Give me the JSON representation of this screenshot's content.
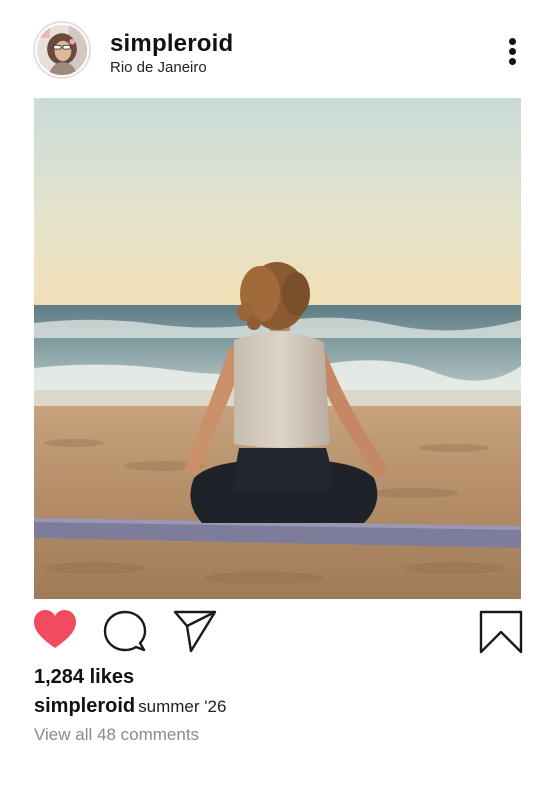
{
  "post": {
    "username": "simpleroid",
    "location": "Rio de Janeiro",
    "likes": "1,284 likes",
    "caption_user": "simpleroid",
    "caption_text": "summer '26",
    "view_comments": "View all 48 comments"
  },
  "actions": {
    "liked": true,
    "saved": false
  },
  "icons": {
    "avatar": "user-avatar",
    "more": "vertical-ellipsis-icon",
    "like": "heart-icon",
    "comment": "speech-bubble-icon",
    "share": "paper-plane-icon",
    "save": "bookmark-icon"
  },
  "colors": {
    "like_active": "#f24b5d",
    "icon_stroke": "#1a1a1a",
    "muted_text": "#8a8a8a"
  }
}
